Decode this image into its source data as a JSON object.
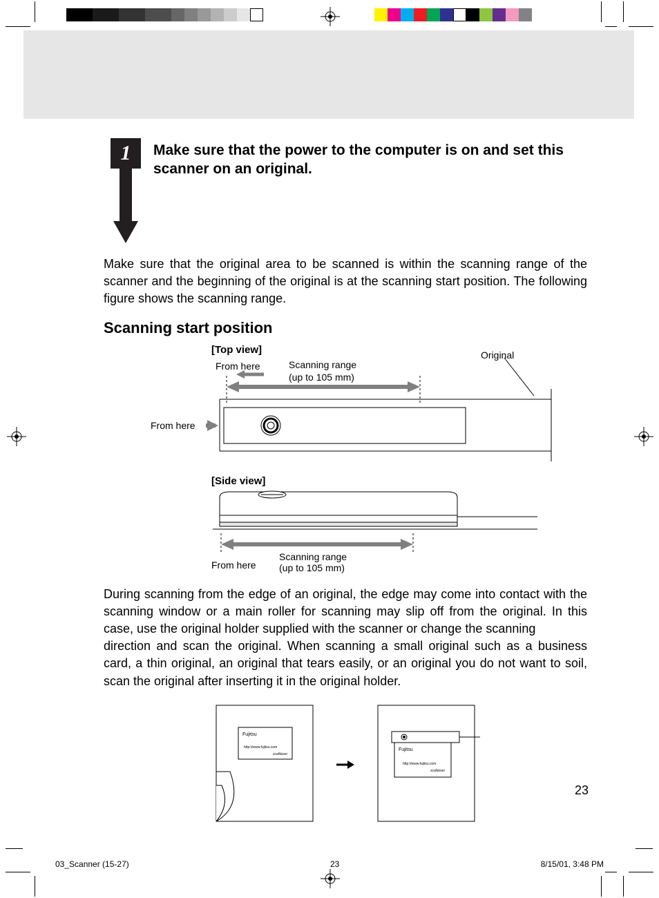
{
  "step": {
    "number": "1",
    "title": "Make sure that the power to the computer is on and set this scanner on an original."
  },
  "para1": "Make sure that the original area to be scanned is within the scanning range of the scanner and the beginning of the original is at the scanning start position. The following figure shows the scanning range.",
  "section_heading": "Scanning start position",
  "topview": {
    "label": "[Top view]",
    "from_here_top": "From here",
    "from_here_left": "From here",
    "range_l1": "Scanning range",
    "range_l2": "(up to 105 mm)",
    "original": "Original"
  },
  "sideview": {
    "label": "[Side view]",
    "from_here": "From here",
    "range_l1": "Scanning range",
    "range_l2": "(up to 105 mm)"
  },
  "para2": "During scanning from the edge of an original, the edge may come into contact with the scanning window or a main roller for scanning may slip off from the original. In this case, use the original holder supplied with the scanner or change the scanning",
  "para3": "direction and scan the original. When scanning a small original such as a business card, a thin original, an original that tears easily, or an original you do not want to soil, scan the original after inserting it in the original holder.",
  "card": {
    "brand": "Fujitsu",
    "url": "http://www.fujitsu.com",
    "model": "scaNexer"
  },
  "page_number": "23",
  "footer": {
    "file": "03_Scanner (15-27)",
    "page": "23",
    "date": "8/15/01, 3:48 PM"
  }
}
